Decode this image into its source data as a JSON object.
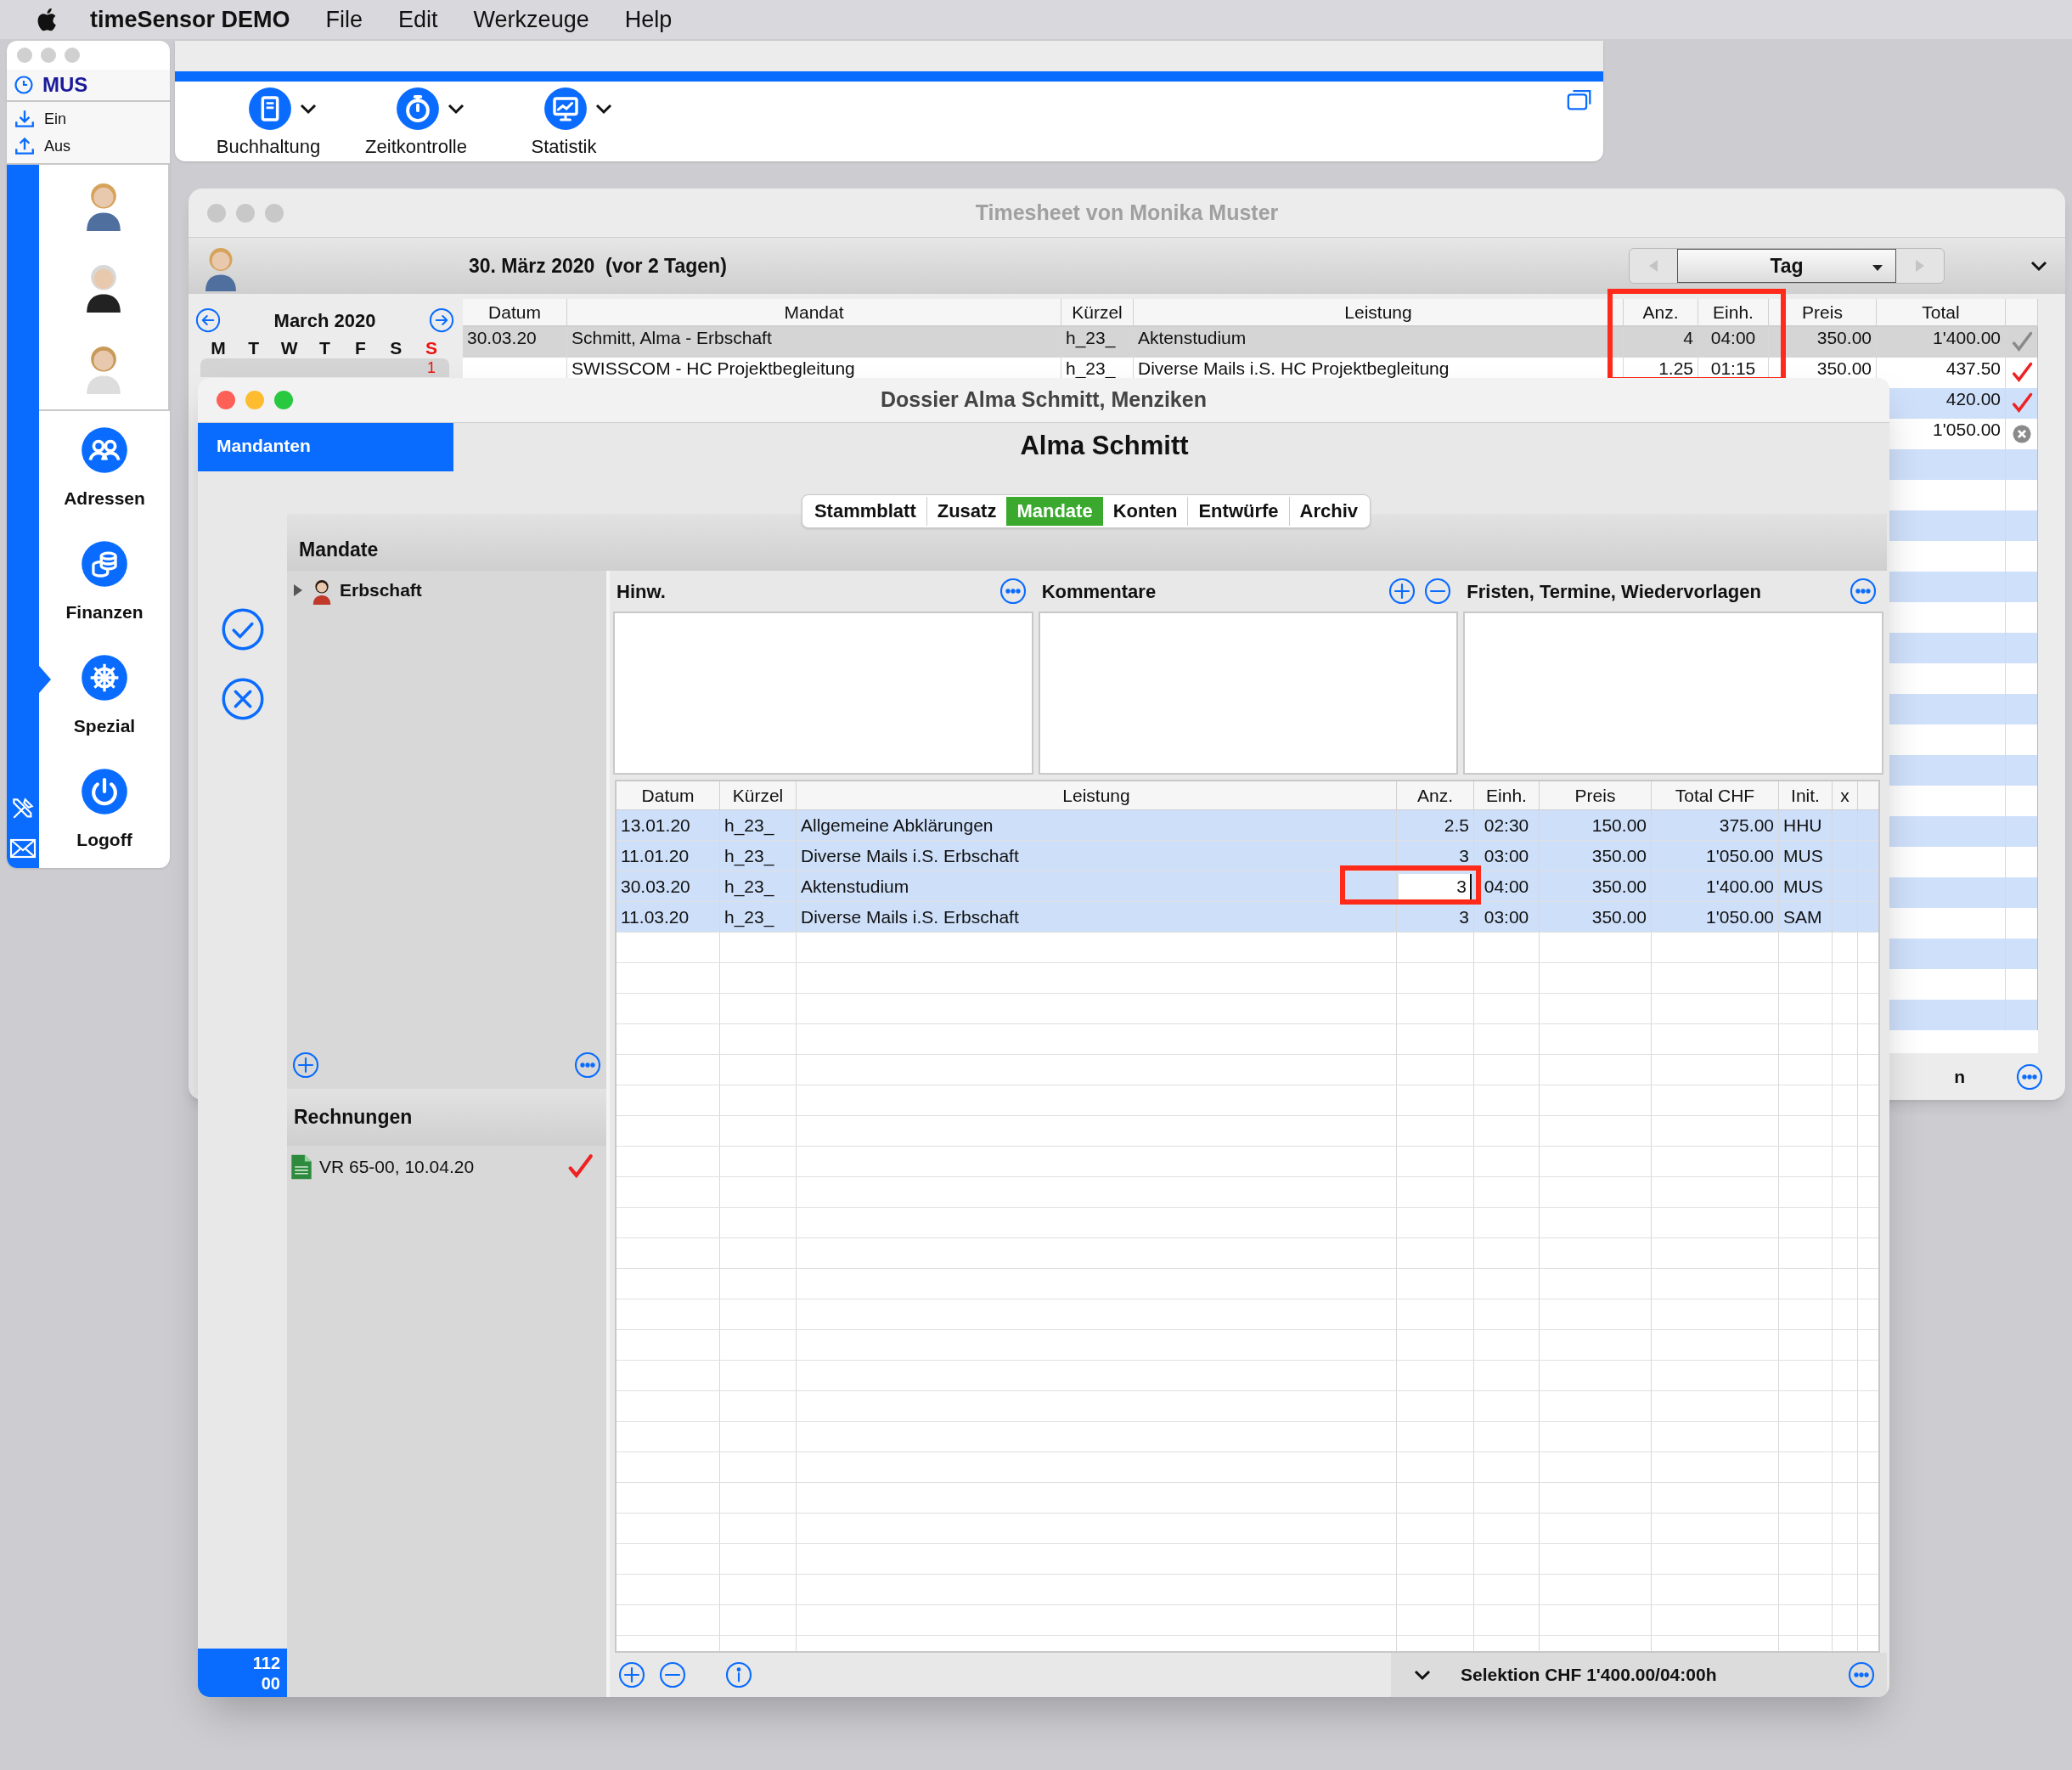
{
  "menu_bar": {
    "app_name": "timeSensor DEMO",
    "items": [
      "File",
      "Edit",
      "Werkzeuge",
      "Help"
    ]
  },
  "palette": {
    "user": "MUS",
    "actions": [
      {
        "label": "Ein",
        "kind": "in"
      },
      {
        "label": "Aus",
        "kind": "out"
      }
    ],
    "nav": [
      {
        "label": "Adressen",
        "kind": "people",
        "selected": false
      },
      {
        "label": "Finanzen",
        "kind": "coins",
        "selected": false
      },
      {
        "label": "Spezial",
        "kind": "wheel",
        "selected": true
      },
      {
        "label": "Logoff",
        "kind": "power",
        "selected": false
      }
    ]
  },
  "toolbar": {
    "buttons": [
      {
        "label": "Buchhaltung",
        "kind": "book"
      },
      {
        "label": "Zeitkontrolle",
        "kind": "stopwatch"
      },
      {
        "label": "Statistik",
        "kind": "chart"
      }
    ]
  },
  "timesheet": {
    "title": "Timesheet von Monika Muster",
    "date": "30. März 2020  (vor 2 Tagen)",
    "period": "Tag",
    "calendar": {
      "month": "March 2020",
      "weekdays": [
        {
          "label": "M",
          "sunday": false
        },
        {
          "label": "T",
          "sunday": false
        },
        {
          "label": "W",
          "sunday": false
        },
        {
          "label": "T",
          "sunday": false
        },
        {
          "label": "F",
          "sunday": false
        },
        {
          "label": "S",
          "sunday": false
        },
        {
          "label": "S",
          "sunday": true
        }
      ],
      "days": [
        "1"
      ]
    },
    "columns": [
      "Datum",
      "Mandat",
      "Kürzel",
      "Leistung",
      "Anz.",
      "Einh.",
      "Preis",
      "Total"
    ],
    "rows": [
      {
        "selected": true,
        "datum": "30.03.20",
        "mandat": "Schmitt, Alma - Erbschaft",
        "kuerzel": "h_23_",
        "leistung": "Aktenstudium",
        "anz": "4",
        "einh": "04:00",
        "preis": "350.00",
        "total": "1'400.00",
        "kind": "done"
      },
      {
        "selected": false,
        "mandat": "SWISSCOM - HC Projektbegleitung",
        "kuerzel": "h_23_",
        "leistung": "Diverse Mails i.S. HC Projektbegleitung",
        "anz": "1.25",
        "einh": "01:15",
        "preis": "350.00",
        "total": "437.50",
        "kind": "billed"
      },
      {
        "selected": false,
        "total": "420.00",
        "kind": "billed"
      },
      {
        "selected": false,
        "total": "1'050.00",
        "kind": "void"
      }
    ],
    "footer_text": "n"
  },
  "dossier": {
    "title": "Dossier Alma Schmitt, Menziken",
    "side_tab": "Mandanten",
    "name": "Alma Schmitt",
    "tabs": [
      {
        "label": "Stammblatt",
        "selected": false
      },
      {
        "label": "Zusatz",
        "selected": false
      },
      {
        "label": "Mandate",
        "selected": true
      },
      {
        "label": "Konten",
        "selected": false
      },
      {
        "label": "Entwürfe",
        "selected": false
      },
      {
        "label": "Archiv",
        "selected": false
      }
    ],
    "section": "Mandate",
    "tree": [
      {
        "label": "Erbschaft",
        "expanded": false
      }
    ],
    "invoices_title": "Rechnungen",
    "invoices": [
      {
        "label": "VR 65-00, 10.04.20",
        "kind": "billed"
      }
    ],
    "notes": [
      {
        "title": "Hinw.",
        "buttons": [
          {
            "kind": "more"
          }
        ]
      },
      {
        "title": "Kommentare",
        "buttons": [
          {
            "kind": "add"
          },
          {
            "kind": "remove"
          }
        ]
      },
      {
        "title": "Fristen, Termine, Wiedervorlagen",
        "buttons": [
          {
            "kind": "more"
          }
        ]
      }
    ],
    "columns": [
      "Datum",
      "Kürzel",
      "Leistung",
      "Anz.",
      "Einh.",
      "Preis",
      "Total CHF",
      "Init.",
      "x"
    ],
    "rows": [
      {
        "selected": true,
        "editing": false,
        "datum": "13.01.20",
        "kuerzel": "h_23_",
        "leistung": "Allgemeine Abklärungen",
        "anz": "2.5",
        "einh": "02:30",
        "preis": "150.00",
        "total": "375.00",
        "init": "HHU"
      },
      {
        "selected": true,
        "editing": false,
        "datum": "11.01.20",
        "kuerzel": "h_23_",
        "leistung": "Diverse Mails i.S. Erbschaft",
        "anz": "3",
        "einh": "03:00",
        "preis": "350.00",
        "total": "1'050.00",
        "init": "MUS"
      },
      {
        "selected": true,
        "editing": true,
        "datum": "30.03.20",
        "kuerzel": "h_23_",
        "leistung": "Aktenstudium",
        "anz": "3",
        "einh": "04:00",
        "preis": "350.00",
        "total": "1'400.00",
        "init": "MUS"
      },
      {
        "selected": true,
        "editing": false,
        "datum": "11.03.20",
        "kuerzel": "h_23_",
        "leistung": "Diverse Mails i.S. Erbschaft",
        "anz": "3",
        "einh": "03:00",
        "preis": "350.00",
        "total": "1'050.00",
        "init": "SAM"
      }
    ],
    "selection": "Selektion CHF 1'400.00/04:00h",
    "counter": [
      "112",
      "00"
    ]
  }
}
